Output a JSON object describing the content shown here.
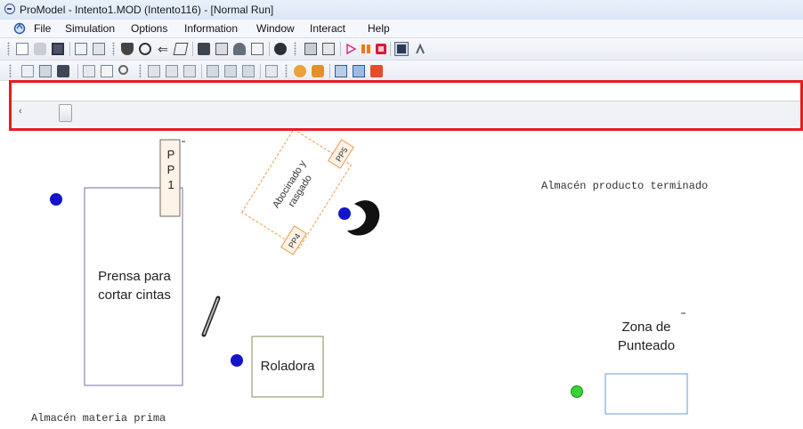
{
  "window": {
    "title": "ProModel - Intento1.MOD (Intento116) - [Normal Run]"
  },
  "menu": [
    "File",
    "Simulation",
    "Options",
    "Information",
    "Window",
    "Interact",
    "Help"
  ],
  "scrollbar": {
    "left_arrow": "‹"
  },
  "layout": {
    "pp1_letters": [
      "P",
      "P",
      "1"
    ],
    "prensa_label": "Prensa para cortar cintas",
    "abocinado_label": "Abocinado y rasgado",
    "pp5_label": "PP5",
    "pp4_label": "PP4",
    "almacen_terminado": "Almacén producto terminado",
    "zona_punteado": "Zona de Punteado",
    "roladora_label": "Roladora",
    "almacen_materia": "Almacén materia prima"
  },
  "colors": {
    "highlight": "#e51c23",
    "entity_blue": "#1414c8",
    "entity_green": "#35d435"
  }
}
